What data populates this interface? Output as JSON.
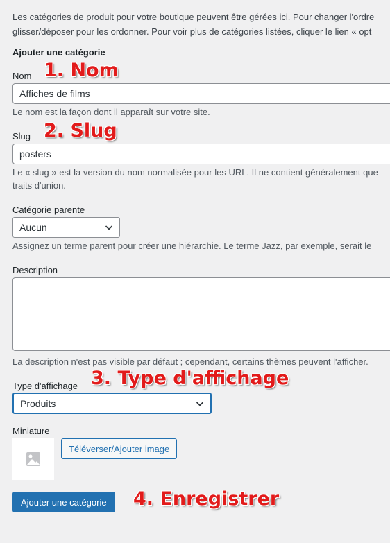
{
  "intro": {
    "line1": "Les catégories de produit pour votre boutique peuvent être gérées ici. Pour changer l'ordre",
    "line2": "glisser/déposer pour les ordonner. Pour voir plus de catégories listées, cliquer le lien « opt"
  },
  "form": {
    "title": "Ajouter une catégorie",
    "name": {
      "label": "Nom",
      "value": "Affiches de films",
      "help": "Le nom est la façon dont il apparaît sur votre site."
    },
    "slug": {
      "label": "Slug",
      "value": "posters",
      "help_line1": "Le « slug » est la version du nom normalisée pour les URL. Il ne contient généralement que",
      "help_line2": "traits d'union."
    },
    "parent": {
      "label": "Catégorie parente",
      "selected": "Aucun",
      "help": "Assignez un terme parent pour créer une hiérarchie. Le terme Jazz, par exemple, serait le"
    },
    "description": {
      "label": "Description",
      "value": "",
      "help": "La description n'est pas visible par défaut ; cependant, certains thèmes peuvent l'afficher."
    },
    "display_type": {
      "label": "Type d'affichage",
      "selected": "Produits"
    },
    "thumbnail": {
      "label": "Miniature",
      "upload_button": "Téléverser/Ajouter image"
    },
    "submit_button": "Ajouter une catégorie"
  },
  "annotations": {
    "a1": "1. Nom",
    "a2": "2. Slug",
    "a3": "3. Type d'affichage",
    "a4": "4. Enregistrer"
  },
  "colors": {
    "background": "#f0f0f1",
    "accent": "#2271b1",
    "annotation": "#e21b1b"
  }
}
